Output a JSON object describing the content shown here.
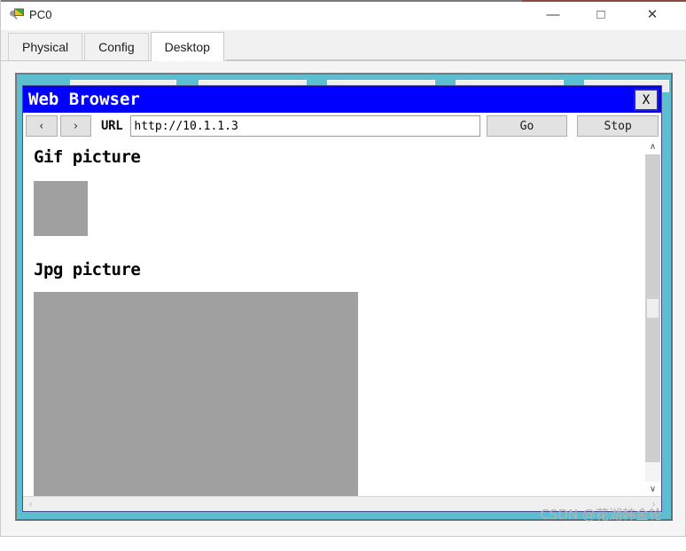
{
  "window": {
    "title": "PC0",
    "icon": "pc-device-icon",
    "controls": {
      "minimize": "—",
      "maximize": "□",
      "close": "✕"
    }
  },
  "tabs": [
    {
      "label": "Physical",
      "active": false
    },
    {
      "label": "Config",
      "active": false
    },
    {
      "label": "Desktop",
      "active": true
    }
  ],
  "desktop": {
    "background_color": "#5dbdd1",
    "hidden_buttons": 5
  },
  "browser": {
    "title": "Web Browser",
    "titlebar_color": "#0000ff",
    "close_label": "X",
    "toolbar": {
      "back_label": "‹",
      "forward_label": "›",
      "url_label": "URL",
      "url_value": "http://10.1.1.3",
      "url_placeholder": "http://",
      "go_label": "Go",
      "stop_label": "Stop"
    },
    "content": {
      "blocks": [
        {
          "heading": "Gif picture",
          "image": "gif-placeholder",
          "color": "#a0a0a0"
        },
        {
          "heading": "Jpg picture",
          "image": "jpg-placeholder",
          "color": "#a0a0a0"
        }
      ]
    },
    "scrollbars": {
      "up_arrow": "∧",
      "down_arrow": "∨",
      "left_arrow": "‹",
      "right_arrow": "›"
    }
  },
  "watermark": "CSDN @花湖韩金轮"
}
